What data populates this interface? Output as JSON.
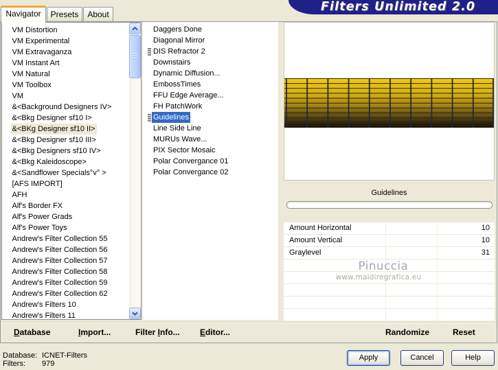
{
  "banner": {
    "title": "Filters Unlimited 2.0"
  },
  "tabs": {
    "navigator": "Navigator",
    "presets": "Presets",
    "about": "About"
  },
  "category_list": {
    "items": [
      {
        "label": "VM Distortion"
      },
      {
        "label": "VM Experimental"
      },
      {
        "label": "VM Extravaganza"
      },
      {
        "label": "VM Instant Art"
      },
      {
        "label": "VM Natural"
      },
      {
        "label": "VM Toolbox"
      },
      {
        "label": "VM"
      },
      {
        "label": "&<Background Designers IV>"
      },
      {
        "label": "&<Bkg Designer sf10 I>"
      },
      {
        "label": "&<BKg Designer sf10 II>",
        "selected": true
      },
      {
        "label": "&<Bkg Designer sf10 III>"
      },
      {
        "label": "&<Bkg Designers sf10 IV>"
      },
      {
        "label": "&<Bkg Kaleidoscope>"
      },
      {
        "label": "&<Sandflower Specials°v° >"
      },
      {
        "label": "[AFS IMPORT]"
      },
      {
        "label": "AFH"
      },
      {
        "label": "Alf's Border FX"
      },
      {
        "label": "Alf's Power Grads"
      },
      {
        "label": "Alf's Power Toys"
      },
      {
        "label": "Andrew's Filter Collection 55"
      },
      {
        "label": "Andrew's Filter Collection 56"
      },
      {
        "label": "Andrew's Filter Collection 57"
      },
      {
        "label": "Andrew's Filter Collection 58"
      },
      {
        "label": "Andrew's Filter Collection 59"
      },
      {
        "label": "Andrew's Filter Collection 62"
      },
      {
        "label": "Andrew's Filters 10"
      },
      {
        "label": "Andrew's Filters 11"
      }
    ]
  },
  "filter_list": {
    "items": [
      {
        "label": "Daggers Done"
      },
      {
        "label": "Diagonal Mirror"
      },
      {
        "label": "DIS Refractor 2",
        "grip": true
      },
      {
        "label": "Downstairs"
      },
      {
        "label": "Dynamic Diffusion..."
      },
      {
        "label": "EmbossTimes"
      },
      {
        "label": "FFU Edge Average..."
      },
      {
        "label": "FH PatchWork"
      },
      {
        "label": "Guidelines",
        "grip": true,
        "selected": true
      },
      {
        "label": "Line Side Line"
      },
      {
        "label": "MURUs Wave..."
      },
      {
        "label": "PIX Sector Mosaic"
      },
      {
        "label": "Polar Convergance 01"
      },
      {
        "label": "Polar Convergance 02"
      }
    ]
  },
  "params": {
    "title": "Guidelines",
    "rows": [
      {
        "name": "Amount Horizontal",
        "value": "10"
      },
      {
        "name": "Amount Vertical",
        "value": "10"
      },
      {
        "name": "Graylevel",
        "value": "31"
      },
      {
        "name": "",
        "value": ""
      },
      {
        "name": "",
        "value": ""
      },
      {
        "name": "",
        "value": ""
      },
      {
        "name": "",
        "value": ""
      },
      {
        "name": "",
        "value": ""
      }
    ]
  },
  "watermark": {
    "line1": "Pinuccia",
    "line2": "www.maidiregrafica.eu"
  },
  "actions": {
    "database": {
      "pre": "",
      "key": "D",
      "post": "atabase"
    },
    "import": {
      "pre": "",
      "key": "I",
      "post": "mport..."
    },
    "filter_info": {
      "pre": "Filter ",
      "key": "I",
      "post": "nfo..."
    },
    "editor": {
      "pre": "",
      "key": "E",
      "post": "ditor..."
    },
    "randomize": "Randomize",
    "reset": "Reset"
  },
  "statusbar": {
    "database_label": "Database:",
    "database_value": "ICNET-Filters",
    "filters_label": "Filters:",
    "filters_value": "979"
  },
  "buttons": {
    "apply": "Apply",
    "cancel": "Cancel",
    "help": "Help"
  },
  "colors": {
    "dialog_bg": "#ece9d8",
    "banner_bg": "#20208a",
    "selection_blue": "#316ac5",
    "tab_accent_orange": "#f49b28",
    "preview_gold_top": "#f2ca0c",
    "preview_dark_bottom": "#1a1306"
  }
}
